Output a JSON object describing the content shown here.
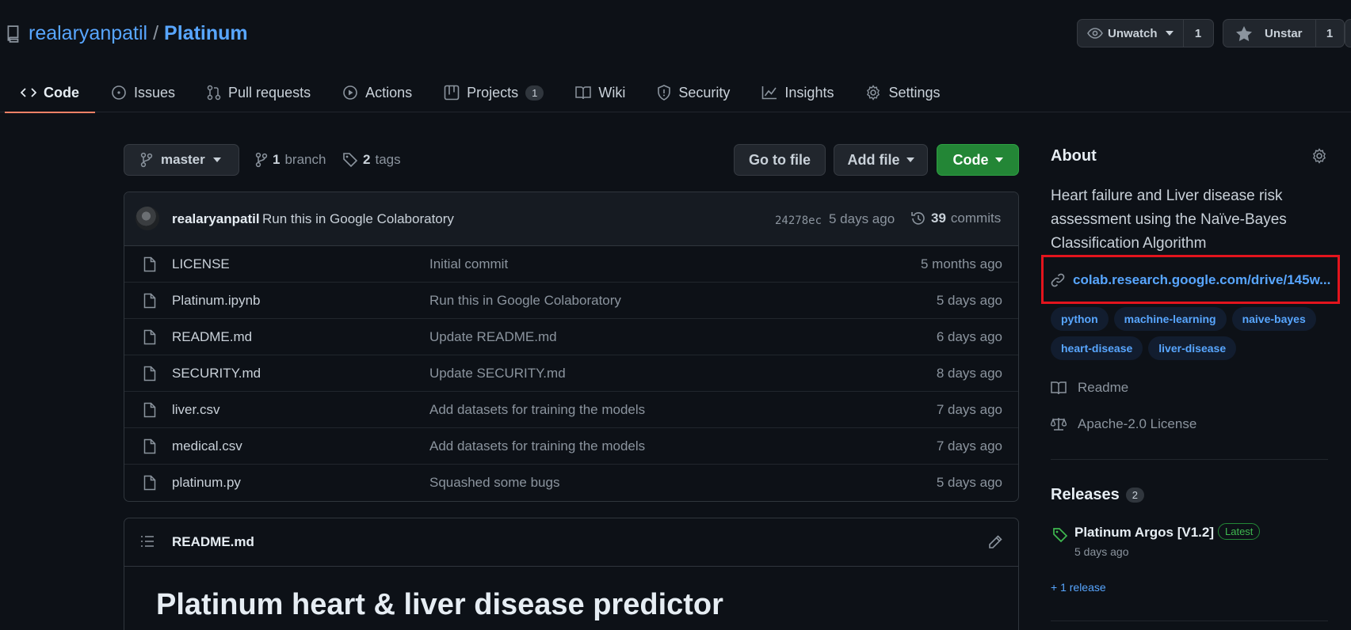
{
  "repo": {
    "owner": "realaryanpatil",
    "separator": "/",
    "name": "Platinum"
  },
  "actions": {
    "unwatch_label": "Unwatch",
    "watch_count": "1",
    "unstar_label": "Unstar",
    "star_count": "1"
  },
  "tabs": [
    {
      "label": "Code",
      "icon": "code-icon",
      "active": true
    },
    {
      "label": "Issues",
      "icon": "issue-icon"
    },
    {
      "label": "Pull requests",
      "icon": "pull-request-icon"
    },
    {
      "label": "Actions",
      "icon": "play-icon"
    },
    {
      "label": "Projects",
      "icon": "table-icon",
      "counter": "1"
    },
    {
      "label": "Wiki",
      "icon": "book-icon"
    },
    {
      "label": "Security",
      "icon": "shield-icon"
    },
    {
      "label": "Insights",
      "icon": "graph-icon"
    },
    {
      "label": "Settings",
      "icon": "gear-icon"
    }
  ],
  "toolbar": {
    "branch": "master",
    "branch_count": "1",
    "branch_word": "branch",
    "tag_count": "2",
    "tag_word": "tags",
    "go_to_file": "Go to file",
    "add_file": "Add file",
    "code": "Code"
  },
  "latest_commit": {
    "author": "realaryanpatil",
    "message": "Run this in Google Colaboratory",
    "sha": "24278ec",
    "time": "5 days ago",
    "commit_count": "39",
    "commit_word": "commits"
  },
  "files": [
    {
      "name": "LICENSE",
      "message": "Initial commit",
      "age": "5 months ago"
    },
    {
      "name": "Platinum.ipynb",
      "message": "Run this in Google Colaboratory",
      "age": "5 days ago"
    },
    {
      "name": "README.md",
      "message": "Update README.md",
      "age": "6 days ago"
    },
    {
      "name": "SECURITY.md",
      "message": "Update SECURITY.md",
      "age": "8 days ago"
    },
    {
      "name": "liver.csv",
      "message": "Add datasets for training the models",
      "age": "7 days ago"
    },
    {
      "name": "medical.csv",
      "message": "Add datasets for training the models",
      "age": "7 days ago"
    },
    {
      "name": "platinum.py",
      "message": "Squashed some bugs",
      "age": "5 days ago"
    }
  ],
  "readme": {
    "file": "README.md",
    "heading": "Platinum heart & liver disease predictor"
  },
  "about": {
    "title": "About",
    "description": "Heart failure and Liver disease risk assessment using the Naïve-Bayes Classification Algorithm",
    "link": "colab.research.google.com/drive/145w...",
    "topics": [
      "python",
      "machine-learning",
      "naive-bayes",
      "heart-disease",
      "liver-disease"
    ],
    "readme_label": "Readme",
    "license_label": "Apache-2.0 License"
  },
  "releases": {
    "title": "Releases",
    "count": "2",
    "latest_name": "Platinum Argos [V1.2]",
    "latest_badge": "Latest",
    "latest_age": "5 days ago",
    "more": "+ 1 release"
  },
  "colors": {
    "background": "#0d1117",
    "link": "#58a6ff",
    "green_button": "#238636",
    "active_tab_underline": "#f78166",
    "highlight_box": "#e3141d"
  }
}
